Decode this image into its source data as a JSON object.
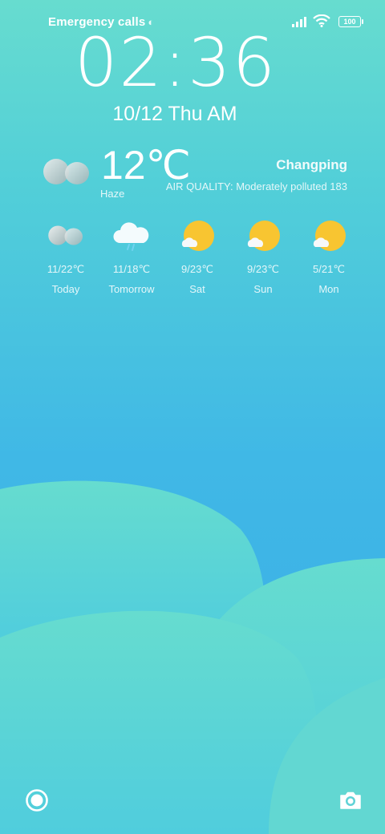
{
  "status_bar": {
    "emergency_text": "Emergency calls",
    "battery": "100"
  },
  "clock": {
    "time": "02:36",
    "date": "10/12",
    "weekday_period": "Thu AM"
  },
  "weather": {
    "temperature": "12℃",
    "condition": "Haze",
    "city": "Changping",
    "air_quality": "AIR QUALITY: Moderately polluted 183",
    "current_icon": "haze-icon",
    "forecast": [
      {
        "range": "11/22℃",
        "label": "Today",
        "icon": "haze-icon"
      },
      {
        "range": "11/18℃",
        "label": "Tomorrow",
        "icon": "rain-cloud-icon"
      },
      {
        "range": "9/23℃",
        "label": "Sat",
        "icon": "sun-cloud-icon"
      },
      {
        "range": "9/23℃",
        "label": "Sun",
        "icon": "sun-cloud-icon"
      },
      {
        "range": "5/21℃",
        "label": "Mon",
        "icon": "sun-cloud-icon"
      }
    ]
  },
  "colors": {
    "sun": "#f8c531",
    "hill": "#66dccf"
  },
  "bottom": {
    "left_icon": "record-icon",
    "right_icon": "camera-icon"
  }
}
